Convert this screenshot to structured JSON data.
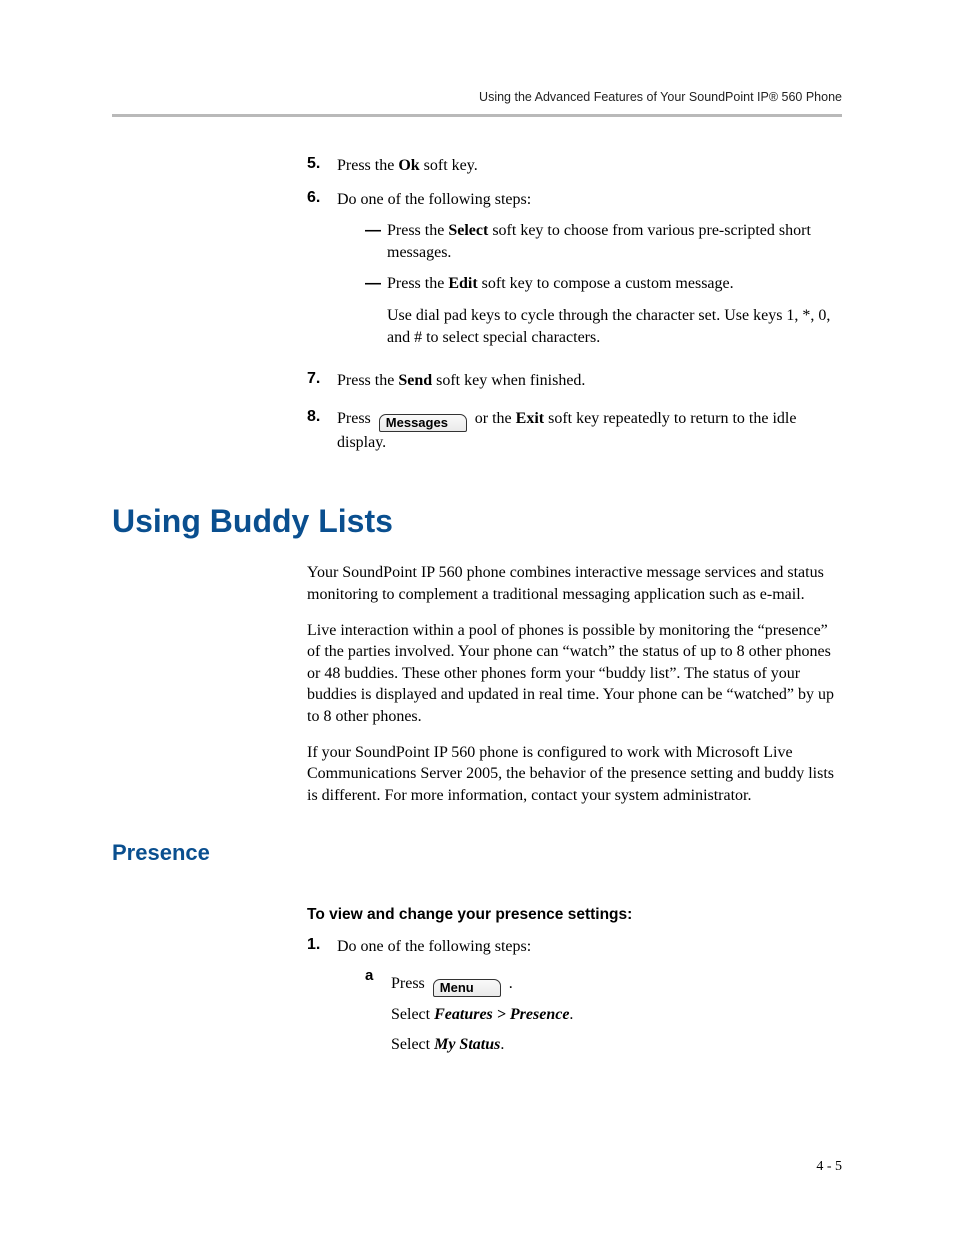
{
  "runningHead": "Using the Advanced Features of Your SoundPoint IP® 560 Phone",
  "steps": {
    "s5": {
      "num": "5.",
      "a": "Press the ",
      "b": "Ok",
      "c": " soft key."
    },
    "s6": {
      "num": "6.",
      "lead": "Do one of the following steps:",
      "opt1": {
        "a": "Press the ",
        "b": "Select",
        "c": " soft key to choose from various pre-scripted short messages."
      },
      "opt2": {
        "a": "Press the ",
        "b": "Edit",
        "c": " soft key to compose a custom message.",
        "note": "Use dial pad keys to cycle through the character set. Use keys 1, *, 0, and # to select special characters."
      }
    },
    "s7": {
      "num": "7.",
      "a": "Press the ",
      "b": "Send",
      "c": " soft key when finished."
    },
    "s8": {
      "num": "8.",
      "a": "Press ",
      "btn": "Messages",
      "b": " or the ",
      "c": "Exit",
      "d": " soft key repeatedly to return to the idle display."
    }
  },
  "h1": "Using Buddy Lists",
  "intro": {
    "p1": "Your SoundPoint IP 560 phone combines interactive message services and status monitoring to complement a traditional messaging application such as e-mail.",
    "p2": "Live interaction within a pool of phones is possible by monitoring the “presence” of the parties involved. Your phone can “watch” the status of up to 8 other phones or 48 buddies. These other phones form your “buddy list”. The status of your buddies is displayed and updated in real time. Your phone can be “watched” by up to 8 other phones.",
    "p3": "If your SoundPoint IP 560 phone is configured to work with Microsoft Live Communications Server 2005, the behavior of the presence setting and buddy lists is different. For more information, contact your system administrator."
  },
  "h2": "Presence",
  "presence": {
    "h3": "To view and change your presence settings:",
    "s1": {
      "num": "1.",
      "lead": "Do one of the following steps:"
    },
    "a": {
      "mark": "a",
      "l1a": "Press ",
      "btn": "Menu",
      "l1b": " .",
      "l2a": "Select ",
      "l2b": "Features > Presence",
      "l2c": ".",
      "l3a": "Select ",
      "l3b": "My Status",
      "l3c": "."
    }
  },
  "footer": "4 - 5"
}
